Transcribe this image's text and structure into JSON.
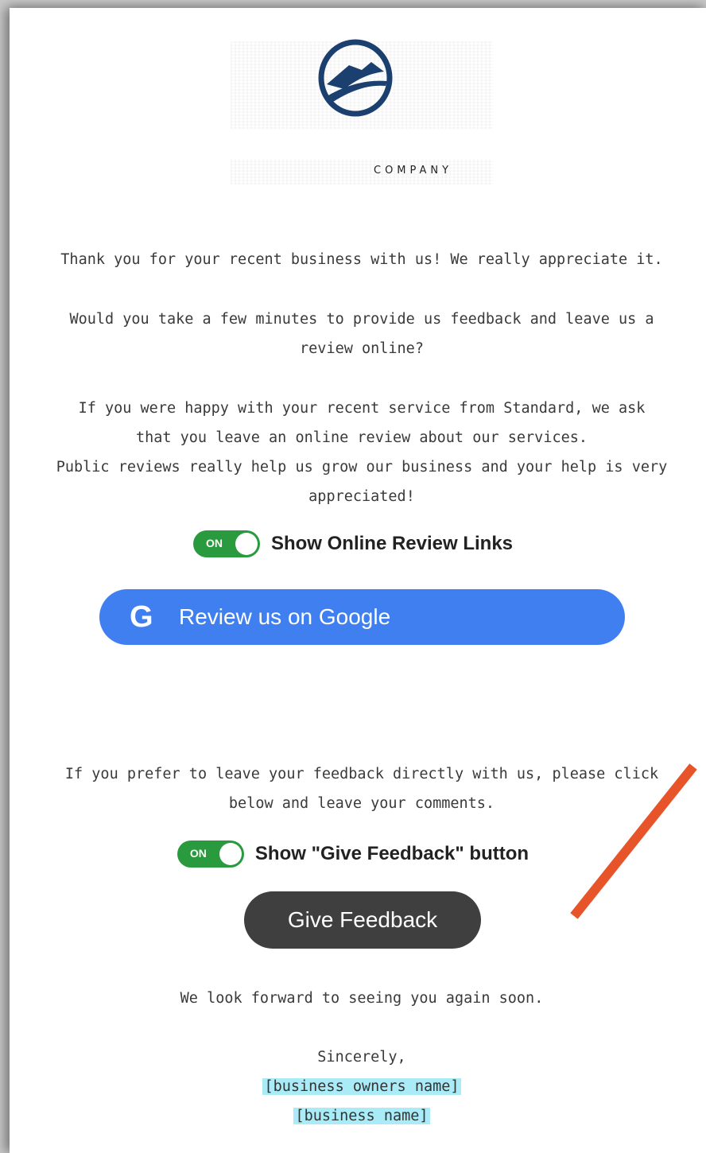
{
  "logo": {
    "company_text": "COMPANY"
  },
  "email": {
    "thanks": "Thank you for your recent business with us! We really appreciate it.",
    "ask_line1": "Would you take a few minutes to provide us feedback and leave us a",
    "ask_line2": "review online?",
    "happy_line1": "If you were happy with your recent service from Standard, we ask",
    "happy_line2": "that you leave an online review about our services.",
    "public_line1": "Public reviews really help us grow our business and your help is very",
    "public_line2": "appreciated!",
    "prefer_line1": "If you prefer to leave your feedback directly with us, please click",
    "prefer_line2": "below and leave your comments.",
    "look_forward": "We look forward to seeing you again soon.",
    "sincerely": "Sincerely,",
    "owner_placeholder": "[business owners name]",
    "business_placeholder": "[business name]"
  },
  "toggles": {
    "review_links": {
      "state": "ON",
      "label": "Show Online Review Links"
    },
    "feedback_button": {
      "state": "ON",
      "label": "Show \"Give Feedback\" button"
    }
  },
  "buttons": {
    "google_icon": "G",
    "google_label": "Review us on Google",
    "feedback_label": "Give Feedback"
  },
  "colors": {
    "google_blue": "#3f7ff0",
    "toggle_green": "#2a9a3e",
    "feedback_dark": "#3f3f3f",
    "placeholder_highlight": "#a9ecf8",
    "annotation_arrow": "#e8542a"
  }
}
